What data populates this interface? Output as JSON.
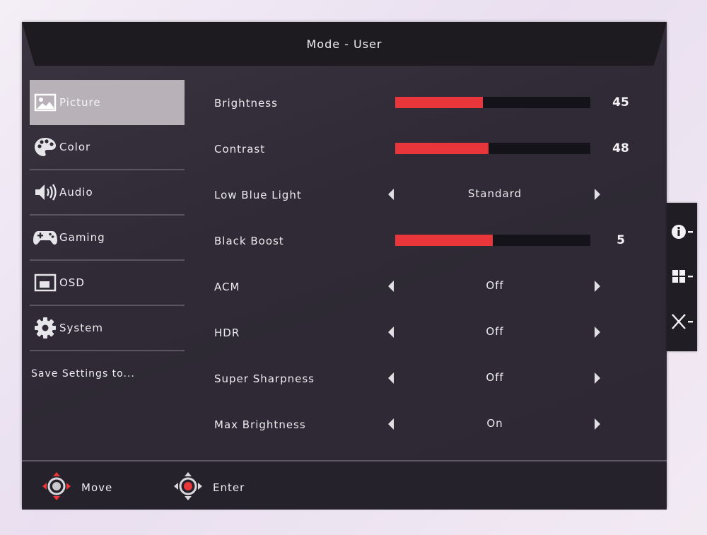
{
  "header": {
    "title": "Mode - User"
  },
  "sidebar": {
    "items": [
      {
        "label": "Picture",
        "icon": "picture-icon",
        "active": true
      },
      {
        "label": "Color",
        "icon": "palette-icon",
        "active": false
      },
      {
        "label": "Audio",
        "icon": "speaker-icon",
        "active": false
      },
      {
        "label": "Gaming",
        "icon": "gamepad-icon",
        "active": false
      },
      {
        "label": "OSD",
        "icon": "osd-icon",
        "active": false
      },
      {
        "label": "System",
        "icon": "gear-icon",
        "active": false
      }
    ],
    "save_label": "Save Settings to..."
  },
  "settings": {
    "brightness": {
      "label": "Brightness",
      "value": "45",
      "fraction": 0.45
    },
    "contrast": {
      "label": "Contrast",
      "value": "48",
      "fraction": 0.48
    },
    "low_blue_light": {
      "label": "Low Blue Light",
      "value": "Standard"
    },
    "black_boost": {
      "label": "Black Boost",
      "value": "5",
      "fraction": 0.5
    },
    "acm": {
      "label": "ACM",
      "value": "Off"
    },
    "hdr": {
      "label": "HDR",
      "value": "Off"
    },
    "super_sharpness": {
      "label": "Super Sharpness",
      "value": "Off"
    },
    "max_brightness": {
      "label": "Max Brightness",
      "value": "On"
    }
  },
  "footer": {
    "move_label": "Move",
    "enter_label": "Enter"
  },
  "side_panel": {
    "icons": [
      "info-icon",
      "input-icon",
      "close-icon"
    ]
  },
  "colors": {
    "accent": "#e8363a",
    "background": "#2f2a35",
    "header": "#1d1a20"
  }
}
